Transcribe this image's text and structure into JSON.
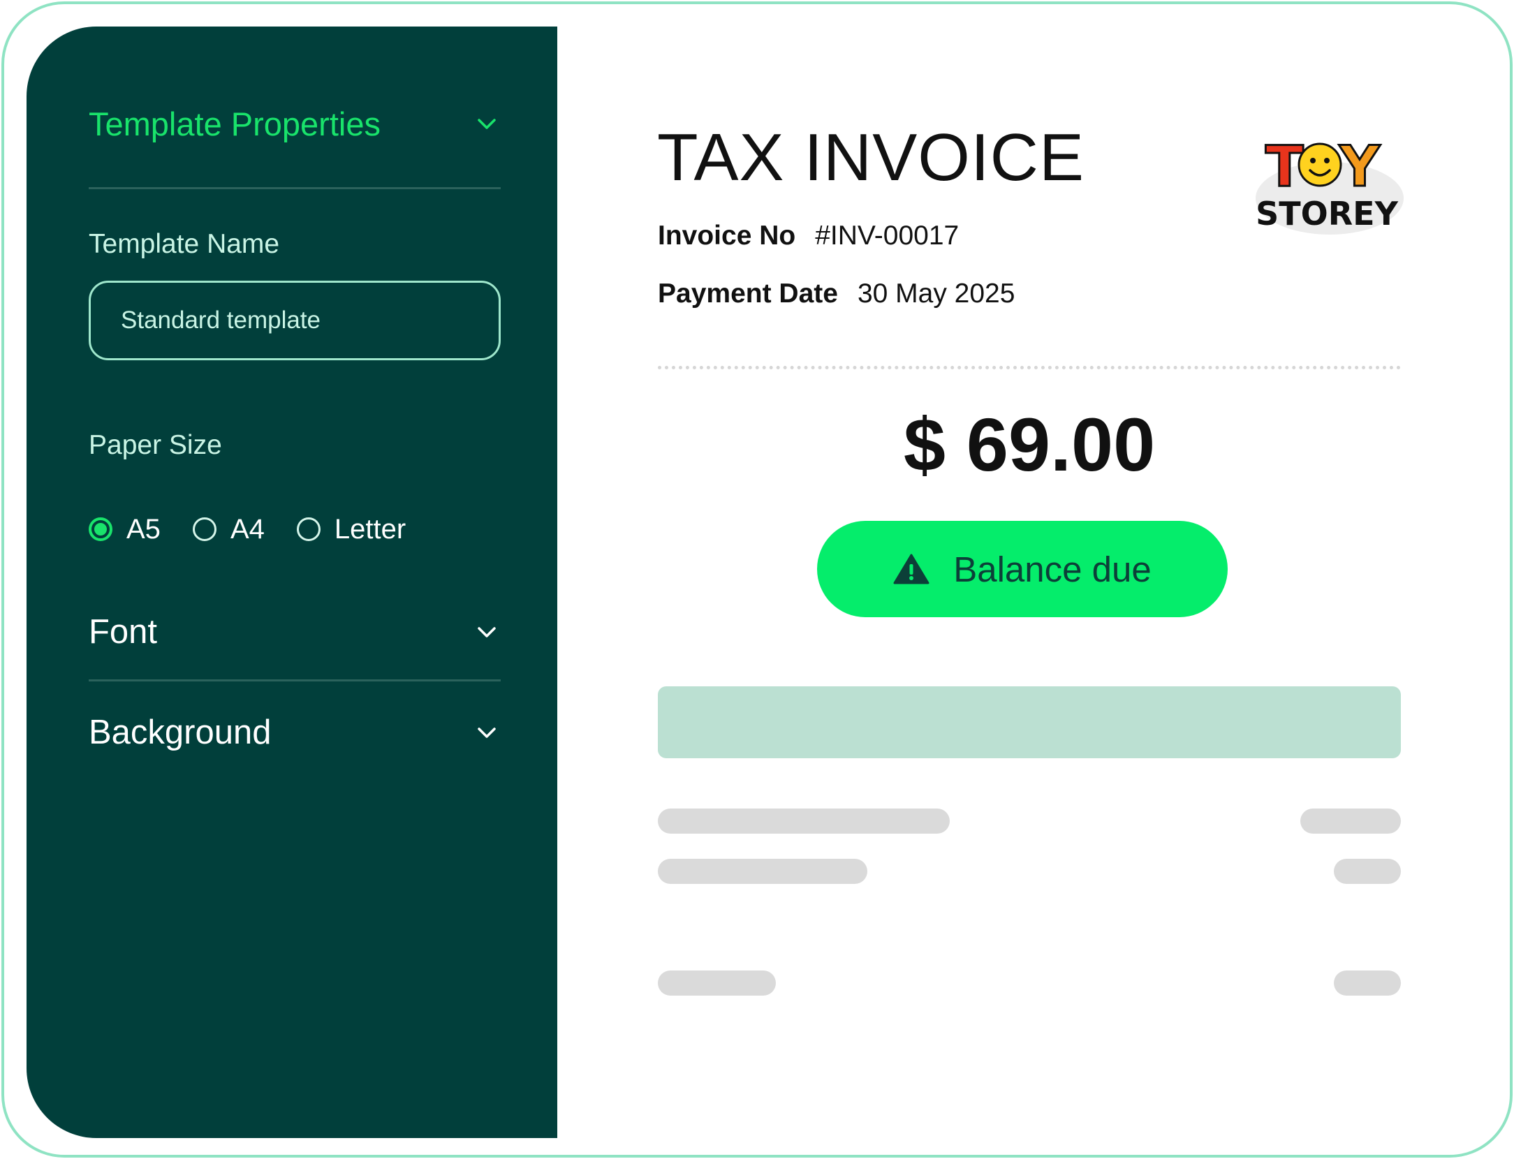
{
  "sidebar": {
    "template_properties": {
      "title": "Template Properties"
    },
    "template_name": {
      "label": "Template Name",
      "value": "Standard template"
    },
    "paper_size": {
      "label": "Paper Size",
      "options": [
        "A5",
        "A4",
        "Letter"
      ],
      "selected": "A5"
    },
    "font": {
      "title": "Font"
    },
    "background": {
      "title": "Background"
    }
  },
  "invoice": {
    "title": "TAX INVOICE",
    "invoice_no_label": "Invoice No",
    "invoice_no": "#INV-00017",
    "payment_date_label": "Payment Date",
    "payment_date": "30 May 2025",
    "amount": "$ 69.00",
    "status": "Balance due",
    "logo": {
      "line1": "TOY",
      "line2": "STOREY"
    }
  },
  "colors": {
    "sidebar_bg": "#013f3b",
    "accent_green": "#19e36b",
    "status_pill": "#05ed6b",
    "frame_border": "#8fe3c3",
    "table_header": "#bbe0d2",
    "skeleton": "#dadada"
  },
  "icons": [
    "chevron-down-icon",
    "warning-triangle-icon",
    "radio-selected-icon",
    "radio-unselected-icon"
  ]
}
